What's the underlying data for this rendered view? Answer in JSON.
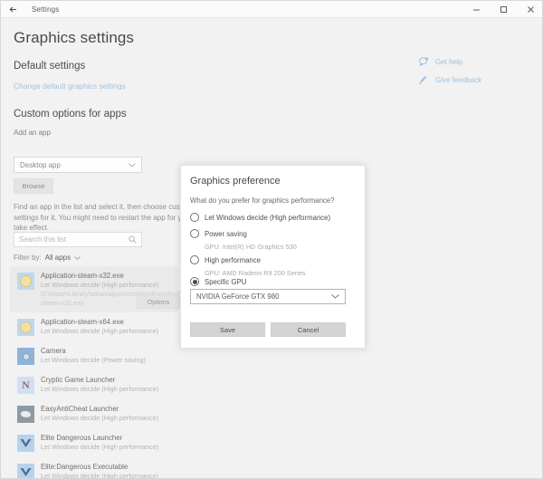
{
  "titlebar": {
    "back_label": "back-arrow",
    "title": "Settings",
    "minimize": "–",
    "maximize": "□",
    "close": "✕"
  },
  "page": {
    "title": "Graphics settings",
    "default_section": {
      "heading": "Default settings",
      "link": "Change default graphics settings"
    },
    "custom_section": {
      "heading": "Custom options for apps",
      "add_an_app_label": "Add an app",
      "app_type_value": "Desktop app",
      "browse_button": "Browse",
      "description": "Find an app in the list and select it, then choose custom graphics settings for it. You might need to restart the app for your changes to take effect.",
      "search_placeholder": "Search this list",
      "search_value": "",
      "filter_label": "Filter by:",
      "filter_value": "All apps"
    },
    "apps": [
      {
        "name": "Application-steam-x32.exe",
        "sub": "Let Windows decide (High performance)",
        "path": "D:\\SteamLibrary\\steamapps\\common\\Banished\\Application-steam-x32.exe",
        "icon": "steam-icon",
        "selected": true,
        "options_button": "Options"
      },
      {
        "name": "Application-steam-x64.exe",
        "sub": "Let Windows decide (High performance)",
        "icon": "steam-icon",
        "selected": false
      },
      {
        "name": "Camera",
        "sub": "Let Windows decide (Power saving)",
        "icon": "camera-icon",
        "selected": false
      },
      {
        "name": "Cryptic Game Launcher",
        "sub": "Let Windows decide (High performance)",
        "icon": "cryptic-icon",
        "selected": false
      },
      {
        "name": "EasyAntiCheat Launcher",
        "sub": "Let Windows decide (High performance)",
        "icon": "easyanticheat-icon",
        "selected": false
      },
      {
        "name": "Elite Dangerous Launcher",
        "sub": "Let Windows decide (High performance)",
        "icon": "elite-icon",
        "selected": false
      },
      {
        "name": "Elite:Dangerous Executable",
        "sub": "Let Windows decide (High performance)",
        "icon": "elite-icon",
        "selected": false
      }
    ],
    "help_links": [
      {
        "label": "Get help",
        "icon": "help-icon"
      },
      {
        "label": "Give feedback",
        "icon": "feedback-icon"
      }
    ]
  },
  "dialog": {
    "title": "Graphics preference",
    "question": "What do you prefer for graphics performance?",
    "options": [
      {
        "label": "Let Windows decide (High performance)",
        "selected": false,
        "gpu": null
      },
      {
        "label": "Power saving",
        "selected": false,
        "gpu": "GPU: Intel(R) HD Graphics 530"
      },
      {
        "label": "High performance",
        "selected": false,
        "gpu": "GPU: AMD Radeon R9 200 Series"
      },
      {
        "label": "Specific GPU",
        "selected": true,
        "gpu": null
      }
    ],
    "gpu_select_value": "NVIDIA GeForce GTX 980",
    "save_button": "Save",
    "cancel_button": "Cancel"
  },
  "colors": {
    "accent_link": "#9fc2e0",
    "window_bg": "#f2f2f2",
    "dialog_bg": "#ffffff",
    "button_bg": "#d4d4d4"
  }
}
